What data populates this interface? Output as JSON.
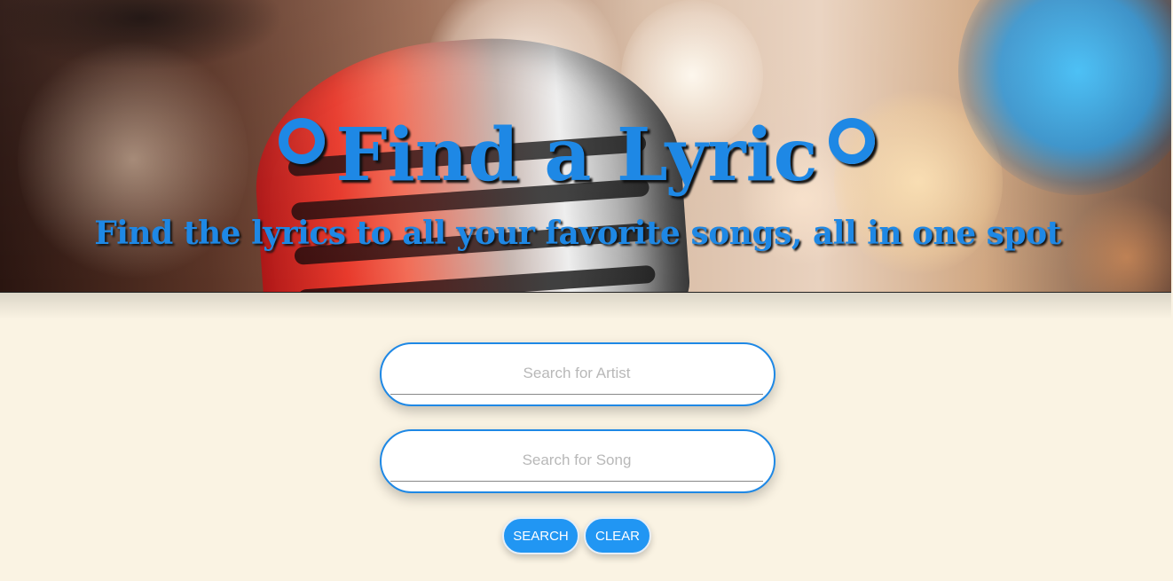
{
  "header": {
    "title": "Find a Lyric",
    "title_icon": "vinyl-record-icon",
    "subtitle": "Find the lyrics to all your favorite songs, all in one spot"
  },
  "form": {
    "artist": {
      "value": "",
      "placeholder": "Search for Artist"
    },
    "song": {
      "value": "",
      "placeholder": "Search for Song"
    },
    "search_button_label": "Search",
    "clear_button_label": "Clear"
  },
  "colors": {
    "accent": "#1e88e5",
    "button": "#2196f3",
    "background": "#faf3e3"
  }
}
